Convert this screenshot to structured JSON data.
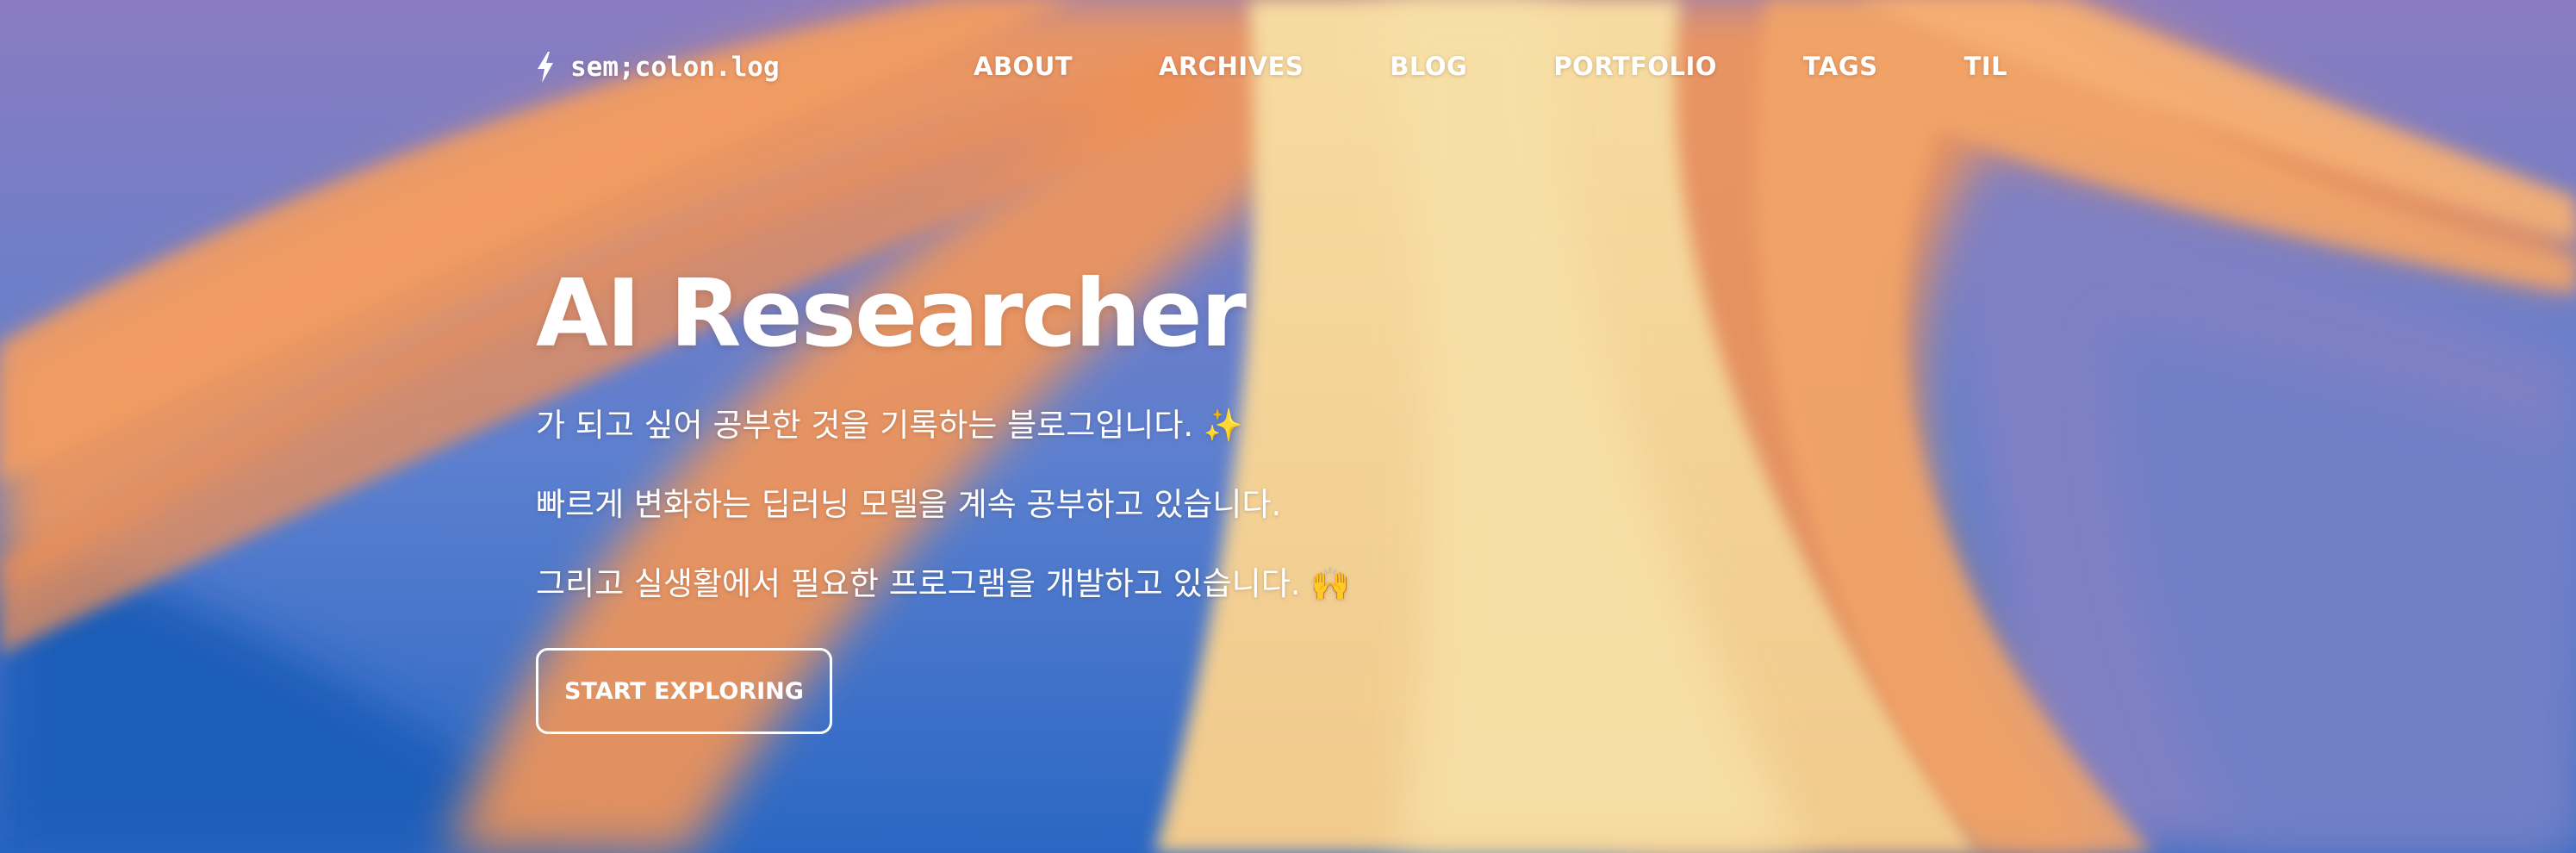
{
  "header": {
    "brand_label": "sem;colon.log",
    "brand_icon": "lightning-bolt-icon",
    "nav": [
      {
        "label": "ABOUT"
      },
      {
        "label": "ARCHIVES"
      },
      {
        "label": "BLOG"
      },
      {
        "label": "PORTFOLIO"
      },
      {
        "label": "TAGS"
      },
      {
        "label": "TIL"
      }
    ]
  },
  "hero": {
    "title": "AI Researcher",
    "lines": [
      "가 되고 싶어 공부한 것을 기록하는 블로그입니다. ✨",
      "빠르게 변화하는 딥러닝 모델을 계속 공부하고 있습니다.",
      "그리고 실생활에서 필요한 프로그램을 개발하고 있습니다. 🙌"
    ],
    "cta_label": "START EXPLORING"
  },
  "colors": {
    "orange": "#f0935a",
    "cream": "#f4d79c",
    "purple": "#9079b6",
    "blue": "#2e72c7",
    "text": "#ffffff"
  }
}
